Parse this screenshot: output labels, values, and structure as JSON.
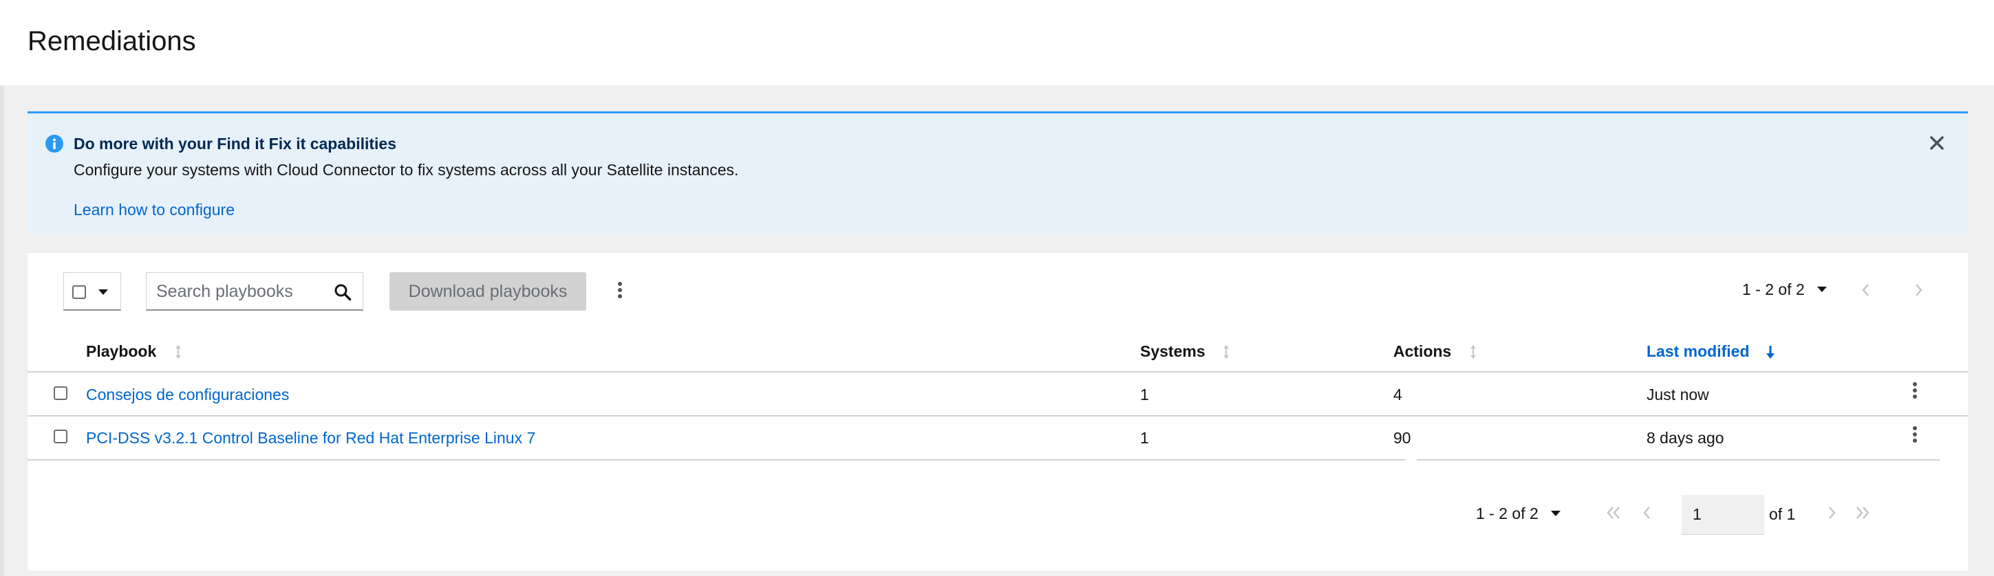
{
  "header": {
    "title": "Remediations"
  },
  "alert": {
    "icon": "info-circle-icon",
    "title": "Do more with your Find it Fix it capabilities",
    "description": "Configure your systems with Cloud Connector to fix systems across all your Satellite instances.",
    "link": "Learn how to configure",
    "close_icon": "close-icon",
    "accent_color": "#2b9af3",
    "background_color": "#e7f1fa"
  },
  "toolbar": {
    "search_placeholder": "Search playbooks",
    "download_label": "Download playbooks",
    "pagination": "1 - 2 of 2"
  },
  "table": {
    "columns": [
      {
        "label": "Playbook",
        "sortable": true
      },
      {
        "label": "Systems",
        "sortable": true
      },
      {
        "label": "Actions",
        "sortable": true
      },
      {
        "label": "Last modified",
        "sortable": true,
        "active": true,
        "direction": "descending"
      }
    ],
    "rows": [
      {
        "playbook": "Consejos de configuraciones",
        "systems": "1",
        "actions": "4",
        "last_modified": "Just now"
      },
      {
        "playbook": "PCI-DSS v3.2.1 Control Baseline for Red Hat Enterprise Linux 7",
        "systems": "1",
        "actions": "90",
        "last_modified": "8 days ago"
      }
    ]
  },
  "pagination_bottom": {
    "range": "1 - 2 of 2",
    "page": "1",
    "of_pages": "of 1"
  },
  "colors": {
    "link": "#0066cc",
    "disabled_button": "#d2d2d2"
  }
}
